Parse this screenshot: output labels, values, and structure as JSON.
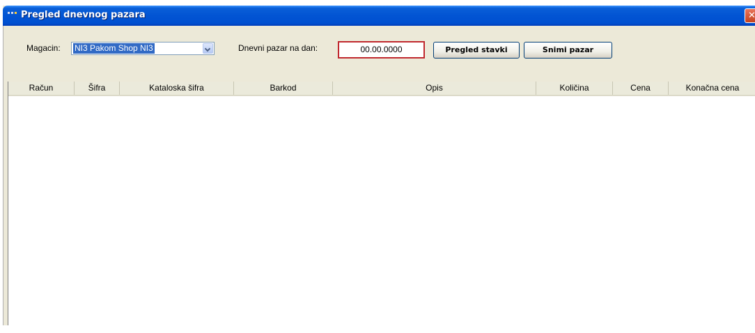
{
  "window": {
    "title": "Pregled dnevnog pazara",
    "close_label": "✕"
  },
  "toolbar": {
    "magacin_label": "Magacin:",
    "magacin_value": "NI3 Pakom Shop NI3",
    "date_label": "Dnevni pazar na dan:",
    "date_value": "00.00.0000",
    "view_button": "Pregled stavki",
    "save_button": "Snimi pazar"
  },
  "table": {
    "columns": [
      "Račun",
      "Šifra",
      "Kataloska šifra",
      "Barkod",
      "Opis",
      "Količina",
      "Cena",
      "Konačna cena"
    ],
    "rows": []
  },
  "colors": {
    "titlebar": "#0254d3",
    "window_bg": "#ece9d8",
    "date_border": "#c0272d",
    "selection": "#316ac5"
  }
}
